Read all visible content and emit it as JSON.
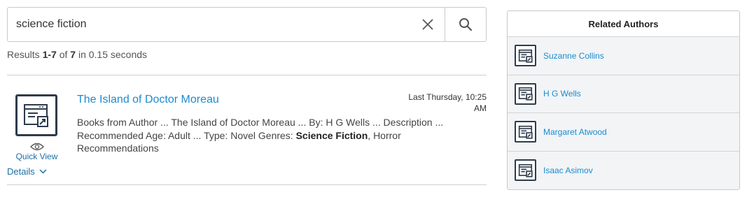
{
  "search": {
    "value": "science fiction"
  },
  "results_info": {
    "prefix": "Results ",
    "range": "1-7",
    "of_text": " of ",
    "total": "7",
    "suffix": " in 0.15 seconds"
  },
  "result": {
    "title": "The Island of Doctor Moreau",
    "date": "Last Thursday, 10:25 AM",
    "desc_part1": "Books from Author ... The Island of Doctor Moreau ... By: H G Wells ... Description ... Recommended Age: Adult ... Type: Novel Genres: ",
    "desc_bold": "Science Fiction",
    "desc_part2": ", Horror Recommendations",
    "quick_view_label": "Quick View",
    "details_label": "Details",
    "icon": "document-link-icon"
  },
  "related_authors": {
    "title": "Related Authors",
    "items": [
      {
        "name": "Suzanne Collins",
        "icon": "document-link-icon"
      },
      {
        "name": "H G Wells",
        "icon": "document-link-icon"
      },
      {
        "name": "Margaret Atwood",
        "icon": "document-link-icon"
      },
      {
        "name": "Isaac Asimov",
        "icon": "document-link-icon"
      }
    ]
  },
  "colors": {
    "link": "#1a8ccf",
    "accent_dark": "#2e3b4b",
    "panel_row_bg": "#f2f4f6"
  }
}
